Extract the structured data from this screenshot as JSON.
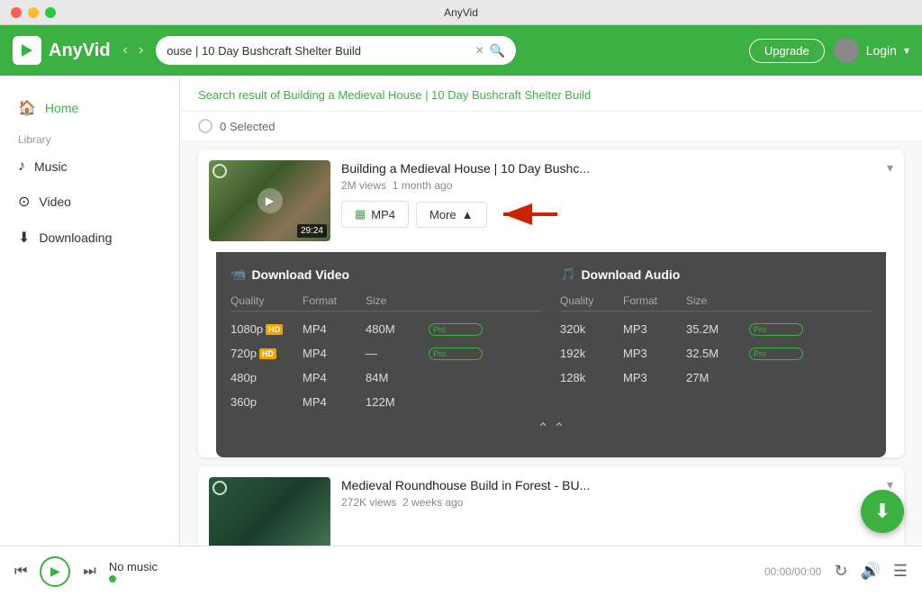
{
  "app": {
    "title": "AnyVid",
    "logo": "A"
  },
  "titlebar": {
    "title": "AnyVid"
  },
  "nav": {
    "back_label": "‹",
    "forward_label": "›",
    "search_value": "ouse | 10 Day Bushcraft Shelter Build",
    "upgrade_label": "Upgrade",
    "login_label": "Login"
  },
  "sidebar": {
    "home_label": "Home",
    "library_label": "Library",
    "music_label": "Music",
    "video_label": "Video",
    "downloading_label": "Downloading"
  },
  "content": {
    "search_result_prefix": "Search result of ",
    "search_result_query": "Building a Medieval House | 10 Day Bushcraft Shelter Build",
    "selected_count": "0 Selected"
  },
  "video1": {
    "title": "Building a Medieval House | 10 Day Bushc...",
    "views": "2M views",
    "ago": "1 month ago",
    "duration": "29:24",
    "mp4_label": "MP4",
    "more_label": "More"
  },
  "download_panel": {
    "video_section_title": "Download Video",
    "audio_section_title": "Download Audio",
    "quality_header": "Quality",
    "format_header": "Format",
    "size_header": "Size",
    "video_rows": [
      {
        "quality": "1080p",
        "hd": true,
        "format": "MP4",
        "size": "480M",
        "pro": true
      },
      {
        "quality": "720p",
        "hd": true,
        "format": "MP4",
        "size": "—",
        "pro": true
      },
      {
        "quality": "480p",
        "hd": false,
        "format": "MP4",
        "size": "84M",
        "pro": false
      },
      {
        "quality": "360p",
        "hd": false,
        "format": "MP4",
        "size": "122M",
        "pro": false
      }
    ],
    "audio_rows": [
      {
        "quality": "320k",
        "format": "MP3",
        "size": "35.2M",
        "pro": true
      },
      {
        "quality": "192k",
        "format": "MP3",
        "size": "32.5M",
        "pro": true
      },
      {
        "quality": "128k",
        "format": "MP3",
        "size": "27M",
        "pro": false
      }
    ]
  },
  "video2": {
    "title": "Medieval Roundhouse Build in Forest - BU...",
    "views": "272K views",
    "ago": "2 weeks ago"
  },
  "player": {
    "no_music": "No music",
    "time": "00:00/00:00"
  }
}
